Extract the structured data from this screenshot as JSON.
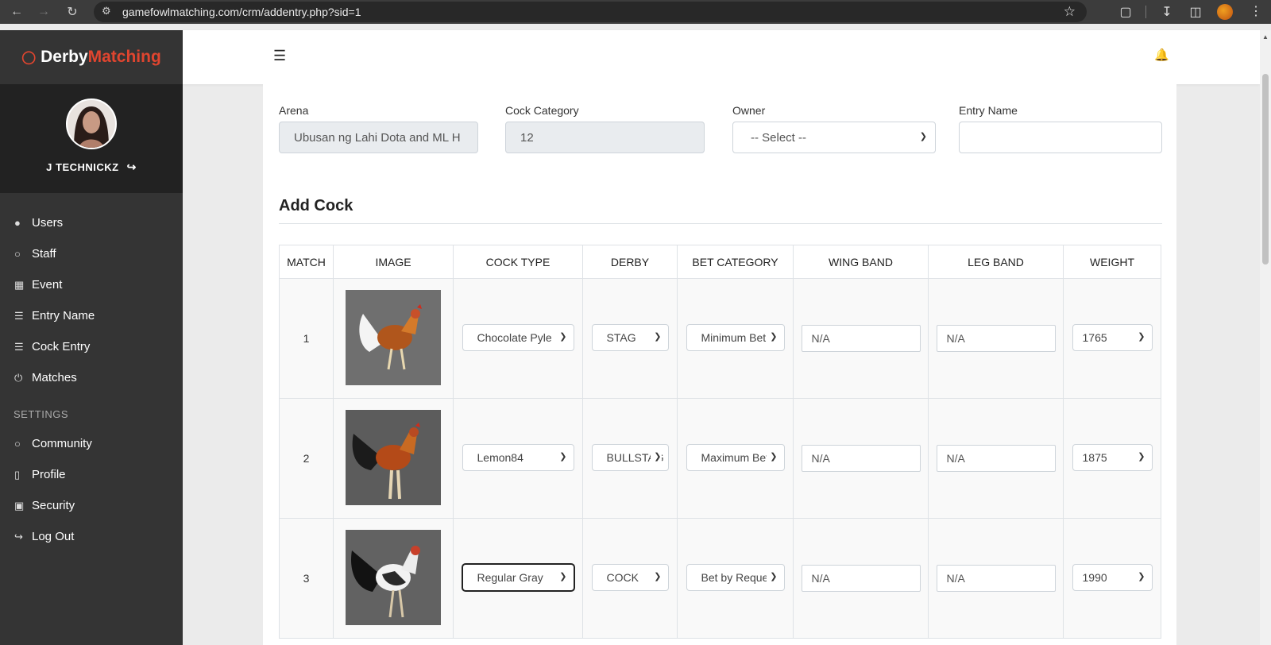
{
  "browser": {
    "url": "gamefowlmatching.com/crm/addentry.php?sid=1"
  },
  "brand": {
    "part1": "Derby",
    "part2": "Matching"
  },
  "user": {
    "name": "J TECHNICKZ"
  },
  "sidebar": {
    "items": [
      {
        "label": "Users",
        "icon": "users-icon"
      },
      {
        "label": "Staff",
        "icon": "user-icon"
      },
      {
        "label": "Event",
        "icon": "calendar-icon"
      },
      {
        "label": "Entry Name",
        "icon": "list-icon"
      },
      {
        "label": "Cock Entry",
        "icon": "list-icon"
      },
      {
        "label": "Matches",
        "icon": "power-icon"
      }
    ],
    "settings_label": "SETTINGS",
    "settings_items": [
      {
        "label": "Community",
        "icon": "chat-icon"
      },
      {
        "label": "Profile",
        "icon": "book-icon"
      },
      {
        "label": "Security",
        "icon": "lock-icon"
      },
      {
        "label": "Log Out",
        "icon": "logout-icon"
      }
    ]
  },
  "form": {
    "arena_label": "Arena",
    "arena_value": "Ubusan ng Lahi Dota and ML H",
    "category_label": "Cock Category",
    "category_value": "12",
    "owner_label": "Owner",
    "owner_value": "-- Select --",
    "entry_label": "Entry Name",
    "entry_value": ""
  },
  "section_title": "Add Cock",
  "table": {
    "headers": [
      "MATCH",
      "IMAGE",
      "COCK TYPE",
      "DERBY",
      "BET CATEGORY",
      "WING BAND",
      "LEG BAND",
      "WEIGHT"
    ],
    "rows": [
      {
        "match": "1",
        "cock_type": "Chocolate Pyle",
        "derby": "STAG",
        "bet_category": "Minimum Bet",
        "wing_band": "N/A",
        "leg_band": "N/A",
        "weight": "1765"
      },
      {
        "match": "2",
        "cock_type": "Lemon84",
        "derby": "BULLSTAG",
        "bet_category": "Maximum Bet",
        "wing_band": "N/A",
        "leg_band": "N/A",
        "weight": "1875"
      },
      {
        "match": "3",
        "cock_type": "Regular Gray",
        "derby": "COCK",
        "bet_category": "Bet by Request",
        "wing_band": "N/A",
        "leg_band": "N/A",
        "weight": "1990"
      }
    ]
  },
  "colors": {
    "accent": "#e0452f",
    "sidebar": "#343434",
    "sidebar_user": "#222222"
  }
}
